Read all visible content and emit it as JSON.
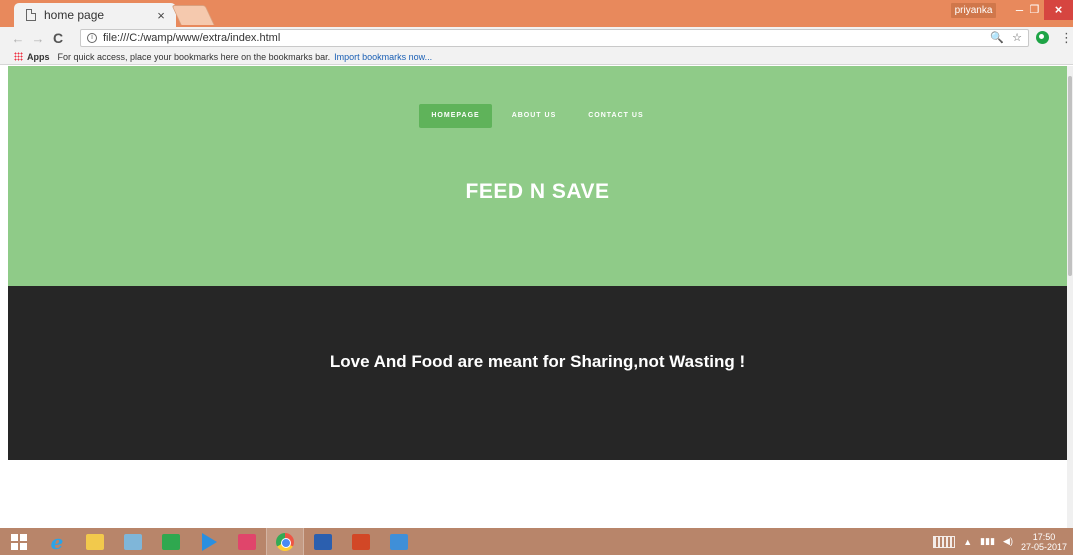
{
  "browser": {
    "tab_title": "home page",
    "tab_close": "×",
    "profile_name": "priyanka",
    "win_min": "–",
    "win_max": "❐",
    "win_close": "×",
    "back": "←",
    "forward": "→",
    "reload": "C",
    "url": "file:///C:/wamp/www/extra/index.html",
    "zoom_icon": "🔍",
    "star_icon": "☆",
    "menu_icon": "⋮"
  },
  "bookmarks": {
    "apps_label": "Apps",
    "hint": "For quick access, place your bookmarks here on the bookmarks bar.",
    "import_link": "Import bookmarks now..."
  },
  "site": {
    "nav": [
      {
        "label": "HOMEPAGE",
        "active": true
      },
      {
        "label": "ABOUT US",
        "active": false
      },
      {
        "label": "CONTACT US",
        "active": false
      }
    ],
    "hero_title": "FEED N SAVE",
    "tagline": "Love And Food are meant for Sharing,not Wasting !"
  },
  "taskbar": {
    "time": "17:50",
    "date": "27-05-2017",
    "tray_arrow": "▲",
    "tray_volume": "◀)"
  },
  "colors": {
    "hero_bg": "#8fcb88",
    "nav_active": "#5fb35a",
    "band_bg": "#262626",
    "titlebar": "#e8895c",
    "taskbar": "#b8856a"
  }
}
